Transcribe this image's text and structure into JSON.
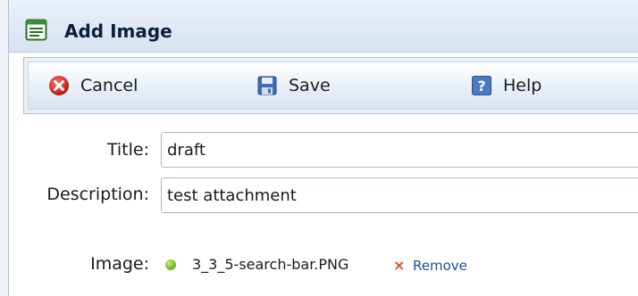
{
  "window": {
    "title": "Add Image",
    "title_icon": "form-window-icon"
  },
  "toolbar": {
    "cancel": {
      "label": "Cancel",
      "icon": "cancel-icon"
    },
    "save": {
      "label": "Save",
      "icon": "floppy-disk-icon"
    },
    "help": {
      "label": "Help",
      "icon": "help-icon"
    }
  },
  "form": {
    "title_label": "Title:",
    "title_value": "draft",
    "description_label": "Description:",
    "description_value": "test attachment",
    "image_label": "Image:",
    "image_status_icon": "status-dot-icon",
    "image_filename": "3_3_5-search-bar.PNG",
    "remove_label": "Remove",
    "remove_icon": "remove-x-icon"
  },
  "colors": {
    "title_bar": "#dde7f2",
    "toolbar": "#e3ebf5",
    "cancel_red": "#d73a2a",
    "status_green": "#7cb62c",
    "remove_orange": "#e04a16",
    "link_blue": "#1f4f9a"
  }
}
